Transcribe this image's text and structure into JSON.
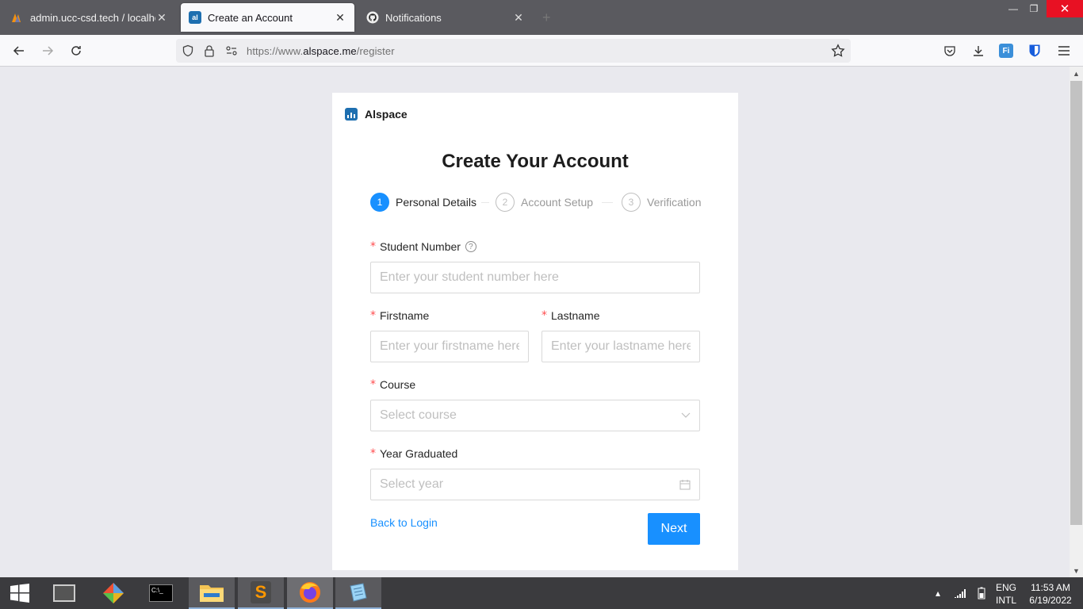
{
  "browser": {
    "tabs": [
      {
        "title": "admin.ucc-csd.tech / localhost",
        "active": false
      },
      {
        "title": "Create an Account",
        "active": true
      },
      {
        "title": "Notifications",
        "active": false
      }
    ],
    "url_prefix": "https://www.",
    "url_host": "alspace.me",
    "url_path": "/register"
  },
  "page": {
    "brand": "Alspace",
    "heading": "Create Your Account",
    "steps": [
      {
        "num": "1",
        "label": "Personal Details",
        "active": true
      },
      {
        "num": "2",
        "label": "Account Setup",
        "active": false
      },
      {
        "num": "3",
        "label": "Verification",
        "active": false
      }
    ],
    "form": {
      "student_number": {
        "label": "Student Number",
        "placeholder": "Enter your student number here"
      },
      "firstname": {
        "label": "Firstname",
        "placeholder": "Enter your firstname here"
      },
      "lastname": {
        "label": "Lastname",
        "placeholder": "Enter your lastname here"
      },
      "course": {
        "label": "Course",
        "placeholder": "Select course"
      },
      "year_graduated": {
        "label": "Year Graduated",
        "placeholder": "Select year"
      },
      "required_mark": "*"
    },
    "back_link": "Back to Login",
    "next_button": "Next"
  },
  "taskbar": {
    "language": "ENG",
    "layout": "INTL",
    "time": "11:53 AM",
    "date": "6/19/2022"
  },
  "colors": {
    "primary": "#1890ff",
    "required": "#ff4d4f",
    "brand_logo": "#1e6fb0"
  }
}
